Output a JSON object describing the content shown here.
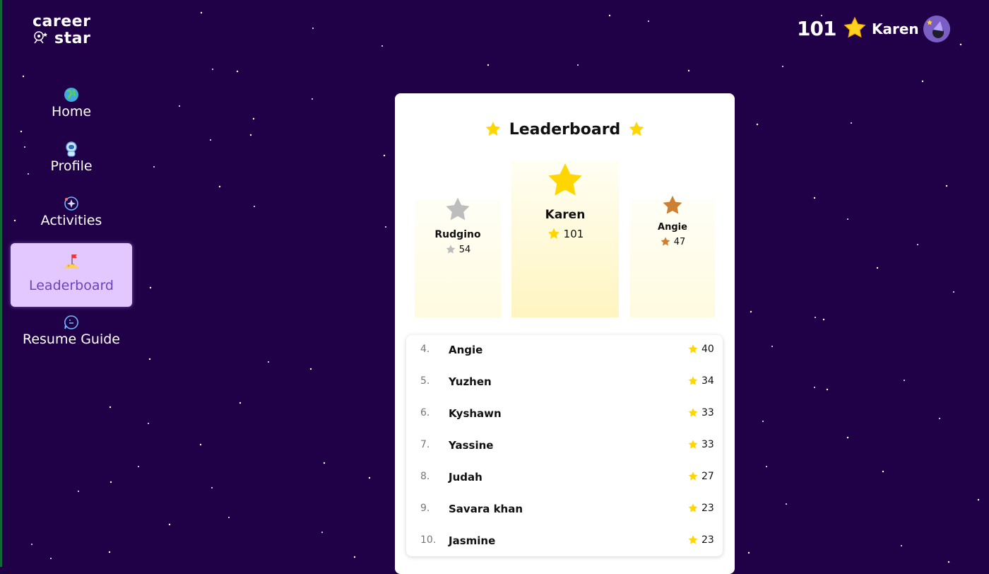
{
  "brand": {
    "line1": "career",
    "line2": "star"
  },
  "header": {
    "score": "101",
    "username": "Karen"
  },
  "nav": [
    {
      "label": "Home",
      "icon": "globe-icon",
      "active": false
    },
    {
      "label": "Profile",
      "icon": "astronaut-icon",
      "active": false
    },
    {
      "label": "Activities",
      "icon": "orbit-icon",
      "active": false
    },
    {
      "label": "Leaderboard",
      "icon": "moon-flag-icon",
      "active": true
    },
    {
      "label": "Resume Guide",
      "icon": "chat-bubble-icon",
      "active": false
    }
  ],
  "leaderboard": {
    "title": "Leaderboard",
    "podium": {
      "first": {
        "name": "Karen",
        "score": "101",
        "color": "#FFD600"
      },
      "second": {
        "name": "Rudgino",
        "score": "54",
        "color": "#BDBDBD"
      },
      "third": {
        "name": "Angie",
        "score": "47",
        "color": "#CD7F32"
      }
    },
    "rows": [
      {
        "rank": "4.",
        "name": "Angie",
        "score": "40"
      },
      {
        "rank": "5.",
        "name": "Yuzhen",
        "score": "34"
      },
      {
        "rank": "6.",
        "name": "Kyshawn",
        "score": "33"
      },
      {
        "rank": "7.",
        "name": "Yassine",
        "score": "33"
      },
      {
        "rank": "8.",
        "name": "Judah",
        "score": "27"
      },
      {
        "rank": "9.",
        "name": "Savara khan",
        "score": "23"
      },
      {
        "rank": "10.",
        "name": "Jasmine",
        "score": "23"
      }
    ]
  },
  "colors": {
    "background": "#200046",
    "gold": "#FFD600",
    "silver": "#BDBDBD",
    "bronze": "#CD7F32",
    "active_nav": "#E2C8FF",
    "active_text": "#6A46B8"
  }
}
